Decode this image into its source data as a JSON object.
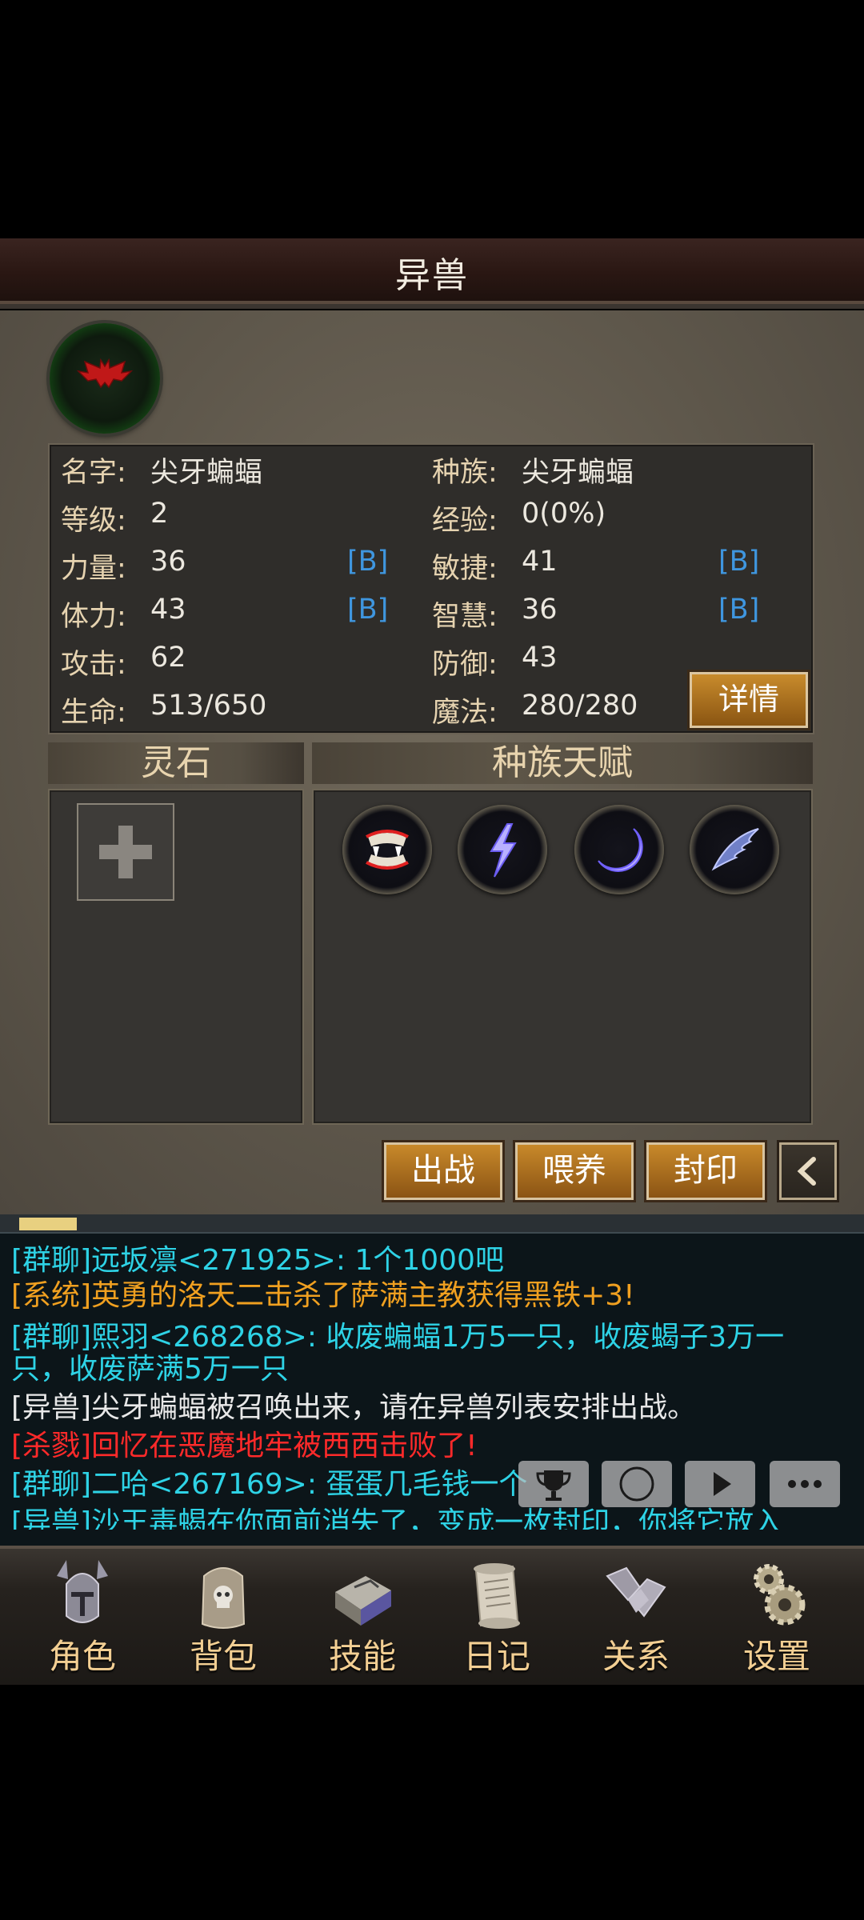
{
  "header": {
    "title": "异兽"
  },
  "stats": {
    "name_label": "名字:",
    "name": "尖牙蝙蝠",
    "race_label": "种族:",
    "race": "尖牙蝙蝠",
    "level_label": "等级:",
    "level": "2",
    "exp_label": "经验:",
    "exp": "0(0%)",
    "str_label": "力量:",
    "str": "36",
    "str_grade": "[B]",
    "agi_label": "敏捷:",
    "agi": "41",
    "agi_grade": "[B]",
    "vit_label": "体力:",
    "vit": "43",
    "vit_grade": "[B]",
    "int_label": "智慧:",
    "int": "36",
    "int_grade": "[B]",
    "atk_label": "攻击:",
    "atk": "62",
    "def_label": "防御:",
    "def": "43",
    "hp_label": "生命:",
    "hp": "513/650",
    "mp_label": "魔法:",
    "mp": "280/280",
    "detail_button": "详情"
  },
  "sections": {
    "spirit_stone": "灵石",
    "race_talent": "种族天赋"
  },
  "talents": [
    "fangs-icon",
    "lightning-icon",
    "crescent-moon-icon",
    "wing-icon"
  ],
  "actions": {
    "deploy": "出战",
    "feed": "喂养",
    "seal": "封印"
  },
  "chat": [
    {
      "text": "[群聊]远坂凛<271925>: 1个1000吧",
      "color": "#2ed3e6"
    },
    {
      "text": "[系统]英勇的洛天二击杀了萨满主教获得黑铁+3!",
      "color": "#f0a020"
    },
    {
      "text": "[群聊]熙羽<268268>: 收废蝙蝠1万5一只，收废蝎子3万一",
      "color": "#2ed3e6"
    },
    {
      "text": "只，收废萨满5万一只",
      "color": "#2ed3e6"
    },
    {
      "text": "[异兽]尖牙蝙蝠被召唤出来，请在异兽列表安排出战。",
      "color": "#e8e8e8"
    },
    {
      "text": "[杀戮]回忆在恶魔地牢被西西击败了!",
      "color": "#ff2a2a"
    },
    {
      "text": "[群聊]二哈<267169>: 蛋蛋几毛钱一个",
      "color": "#2ed3e6"
    },
    {
      "text": "[异兽]沙王毒蝎在你面前消失了，变成一枚封印，你将它放入",
      "color": "#2ed3e6"
    }
  ],
  "chat_tools": [
    "trophy-icon",
    "compass-icon",
    "play-icon",
    "more-icon"
  ],
  "nav": [
    {
      "label": "角色",
      "icon": "helmet-icon"
    },
    {
      "label": "背包",
      "icon": "backpack-icon"
    },
    {
      "label": "技能",
      "icon": "skill-book-icon"
    },
    {
      "label": "日记",
      "icon": "scroll-icon"
    },
    {
      "label": "关系",
      "icon": "handshake-icon"
    },
    {
      "label": "设置",
      "icon": "gears-icon"
    }
  ]
}
